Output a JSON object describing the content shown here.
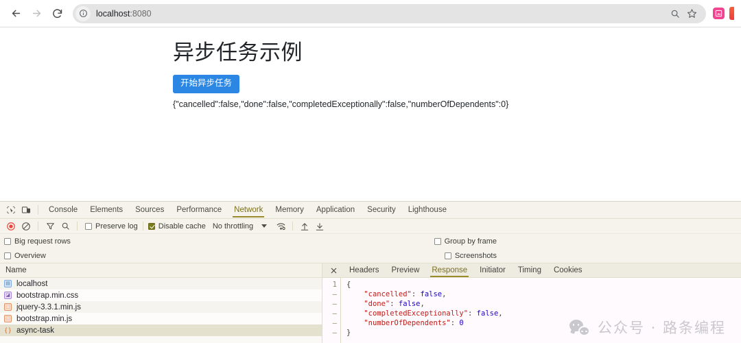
{
  "browser": {
    "back_label": "Back",
    "forward_label": "Forward",
    "reload_label": "Reload",
    "site_info_label": "View site information",
    "url_host": "localhost",
    "url_port": ":8080",
    "url_full": "localhost:8080",
    "search_label": "Search",
    "bookmark_label": "Bookmark this tab",
    "extensions": [
      "extension-pink",
      "extension-orange"
    ]
  },
  "page": {
    "title": "异步任务示例",
    "button_label": "开始异步任务",
    "result_text": "{\"cancelled\":false,\"done\":false,\"completedExceptionally\":false,\"numberOfDependents\":0}"
  },
  "devtools": {
    "inspect_icon_label": "Inspect element",
    "device_icon_label": "Toggle device toolbar",
    "tabs": [
      {
        "label": "Console",
        "active": false
      },
      {
        "label": "Elements",
        "active": false
      },
      {
        "label": "Sources",
        "active": false
      },
      {
        "label": "Performance",
        "active": false
      },
      {
        "label": "Network",
        "active": true
      },
      {
        "label": "Memory",
        "active": false
      },
      {
        "label": "Application",
        "active": false
      },
      {
        "label": "Security",
        "active": false
      },
      {
        "label": "Lighthouse",
        "active": false
      }
    ],
    "toolbar": {
      "record_label": "Stop recording network log",
      "clear_label": "Clear",
      "filter_label": "Filter",
      "search_label": "Search",
      "preserve_log_label": "Preserve log",
      "preserve_log_checked": false,
      "disable_cache_label": "Disable cache",
      "disable_cache_checked": true,
      "throttling_value": "No throttling",
      "wifi_label": "Network conditions",
      "import_label": "Import HAR file",
      "export_label": "Export HAR file"
    },
    "options": {
      "big_request_rows_label": "Big request rows",
      "big_request_rows_checked": false,
      "overview_label": "Overview",
      "overview_checked": false,
      "group_by_frame_label": "Group by frame",
      "group_by_frame_checked": false,
      "screenshots_label": "Screenshots",
      "screenshots_checked": false
    },
    "requests": {
      "column_name": "Name",
      "rows": [
        {
          "name": "localhost",
          "type": "doc",
          "glyph": "▤",
          "selected": false
        },
        {
          "name": "bootstrap.min.css",
          "type": "css",
          "glyph": "◪",
          "selected": false
        },
        {
          "name": "jquery-3.3.1.min.js",
          "type": "js",
          "glyph": "⬚",
          "selected": false
        },
        {
          "name": "bootstrap.min.js",
          "type": "js",
          "glyph": "⬚",
          "selected": false
        },
        {
          "name": "async-task",
          "type": "json",
          "glyph": "{ }",
          "selected": true
        }
      ]
    },
    "detail": {
      "close_label": "Close",
      "tabs": [
        {
          "label": "Headers",
          "active": false
        },
        {
          "label": "Preview",
          "active": false
        },
        {
          "label": "Response",
          "active": true
        },
        {
          "label": "Initiator",
          "active": false
        },
        {
          "label": "Timing",
          "active": false
        },
        {
          "label": "Cookies",
          "active": false
        }
      ],
      "gutter": [
        "1",
        "–",
        "–",
        "–",
        "–",
        "–"
      ],
      "response_lines": [
        {
          "indent": 0,
          "segments": [
            {
              "t": "{",
              "c": "p"
            }
          ]
        },
        {
          "indent": 1,
          "segments": [
            {
              "t": "\"cancelled\"",
              "c": "k"
            },
            {
              "t": ": ",
              "c": "p"
            },
            {
              "t": "false",
              "c": "b"
            },
            {
              "t": ",",
              "c": "p"
            }
          ]
        },
        {
          "indent": 1,
          "segments": [
            {
              "t": "\"done\"",
              "c": "k"
            },
            {
              "t": ": ",
              "c": "p"
            },
            {
              "t": "false",
              "c": "b"
            },
            {
              "t": ",",
              "c": "p"
            }
          ]
        },
        {
          "indent": 1,
          "segments": [
            {
              "t": "\"completedExceptionally\"",
              "c": "k"
            },
            {
              "t": ": ",
              "c": "p"
            },
            {
              "t": "false",
              "c": "b"
            },
            {
              "t": ",",
              "c": "p"
            }
          ]
        },
        {
          "indent": 1,
          "segments": [
            {
              "t": "\"numberOfDependents\"",
              "c": "k"
            },
            {
              "t": ": ",
              "c": "p"
            },
            {
              "t": "0",
              "c": "n"
            }
          ]
        },
        {
          "indent": 0,
          "segments": [
            {
              "t": "}",
              "c": "p"
            }
          ]
        }
      ]
    }
  },
  "watermark": {
    "text": "公众号 · 路条编程",
    "icon": "wechat-icon"
  },
  "colors": {
    "accent_button": "#2b87e3",
    "devtools_active_tab": "#7a6f1e",
    "record_red": "#e8453c",
    "json_key": "#c41a16",
    "json_value": "#1c00cf",
    "selection": "#e4e2cf"
  }
}
